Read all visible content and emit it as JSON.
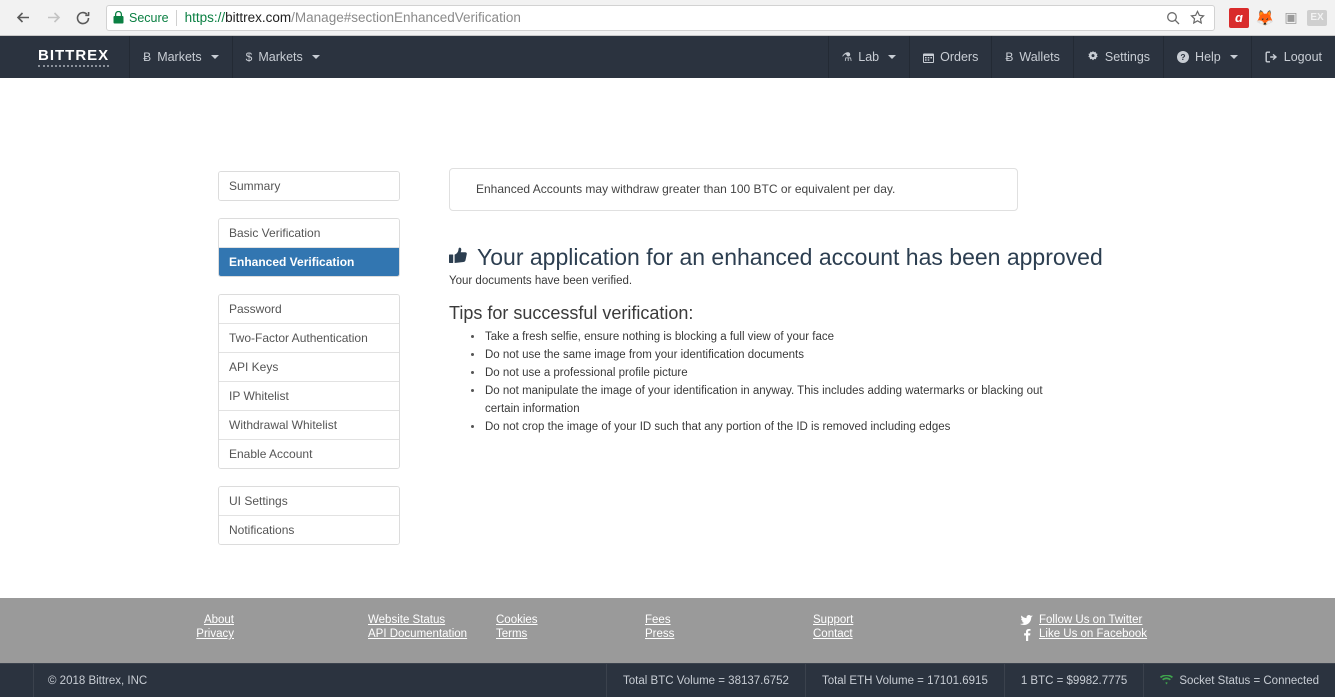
{
  "browser": {
    "back_icon": "back-arrow-icon",
    "forward_icon": "forward-arrow-icon",
    "reload_icon": "reload-icon",
    "secure_label": "Secure",
    "url_scheme": "https://",
    "url_host": "bittrex.com",
    "url_path": "/Manage#sectionEnhancedVerification",
    "zoom_icon": "search-icon",
    "bookmark_icon": "star-icon",
    "extensions": [
      {
        "name": "avira-extension-icon",
        "glyph": "ɑ"
      },
      {
        "name": "firefox-extension-icon",
        "glyph": "🦊"
      },
      {
        "name": "window-extension-icon",
        "glyph": "▣"
      },
      {
        "name": "ex-extension-icon",
        "glyph": "EX"
      }
    ]
  },
  "navbar": {
    "brand": "BITTREX",
    "left_items": [
      {
        "label": "Markets",
        "icon": "bitcoin-icon",
        "glyph": "Ƀ",
        "caret": true
      },
      {
        "label": "Markets",
        "icon": "dollar-icon",
        "glyph": "$",
        "caret": true
      }
    ],
    "right_items": [
      {
        "label": "Lab",
        "icon": "flask-icon",
        "glyph": "⚗",
        "caret": true
      },
      {
        "label": "Orders",
        "icon": "calendar-icon",
        "glyph": "☷",
        "caret": false
      },
      {
        "label": "Wallets",
        "icon": "bitcoin-icon",
        "glyph": "Ƀ",
        "caret": false
      },
      {
        "label": "Settings",
        "icon": "gear-icon",
        "glyph": "⚙",
        "caret": false
      },
      {
        "label": "Help",
        "icon": "question-circle-icon",
        "glyph": "❓",
        "caret": true
      },
      {
        "label": "Logout",
        "icon": "logout-icon",
        "glyph": "⇥",
        "caret": false
      }
    ]
  },
  "sidebar": {
    "groups": [
      {
        "items": [
          {
            "label": "Summary",
            "active": false
          }
        ]
      },
      {
        "items": [
          {
            "label": "Basic Verification",
            "active": false
          },
          {
            "label": "Enhanced Verification",
            "active": true
          }
        ]
      },
      {
        "items": [
          {
            "label": "Password",
            "active": false
          },
          {
            "label": "Two-Factor Authentication",
            "active": false
          },
          {
            "label": "API Keys",
            "active": false
          },
          {
            "label": "IP Whitelist",
            "active": false
          },
          {
            "label": "Withdrawal Whitelist",
            "active": false
          },
          {
            "label": "Enable Account",
            "active": false
          }
        ]
      },
      {
        "items": [
          {
            "label": "UI Settings",
            "active": false
          },
          {
            "label": "Notifications",
            "active": false
          }
        ]
      }
    ]
  },
  "main": {
    "alert": "Enhanced Accounts may withdraw greater than 100 BTC or equivalent per day.",
    "thumb_icon": "thumbs-up-icon",
    "headline": "Your application for an enhanced account has been approved",
    "subline": "Your documents have been verified.",
    "tips_title": "Tips for successful verification:",
    "tips": [
      "Take a fresh selfie, ensure nothing is blocking a full view of your face",
      "Do not use the same image from your identification documents",
      "Do not use a professional profile picture",
      "Do not manipulate the image of your identification in anyway. This includes adding watermarks or blacking out certain information",
      "Do not crop the image of your ID such that any portion of the ID is removed including edges"
    ]
  },
  "footer": {
    "columns": [
      {
        "links": [
          "About",
          "Privacy"
        ]
      },
      {
        "links": [
          "Website Status",
          "API Documentation"
        ]
      },
      {
        "links": [
          "Cookies",
          "Terms"
        ]
      },
      {
        "links": [
          "Fees",
          "Press"
        ]
      },
      {
        "links": [
          "Support",
          "Contact"
        ]
      }
    ],
    "social": [
      {
        "label": "Follow Us on Twitter",
        "icon": "twitter-icon",
        "glyph": "🐦"
      },
      {
        "label": "Like Us on Facebook",
        "icon": "facebook-icon",
        "glyph": "f"
      }
    ]
  },
  "statusbar": {
    "copyright": "© 2018 Bittrex, INC",
    "cells": [
      {
        "text": "Total BTC Volume = 38137.6752",
        "icon": null
      },
      {
        "text": "Total ETH Volume = 17101.6915",
        "icon": null
      },
      {
        "text": "1 BTC = $9982.7775",
        "icon": null
      },
      {
        "text": "Socket Status = Connected",
        "icon": "wifi-icon"
      }
    ]
  },
  "colors": {
    "navbar_bg": "#2b333f",
    "active_item": "#3276b1",
    "footer_bg": "#9a9a9a",
    "heading": "#2c3e50",
    "secure_green": "#0b8043",
    "socket_green": "#3fa34d"
  }
}
